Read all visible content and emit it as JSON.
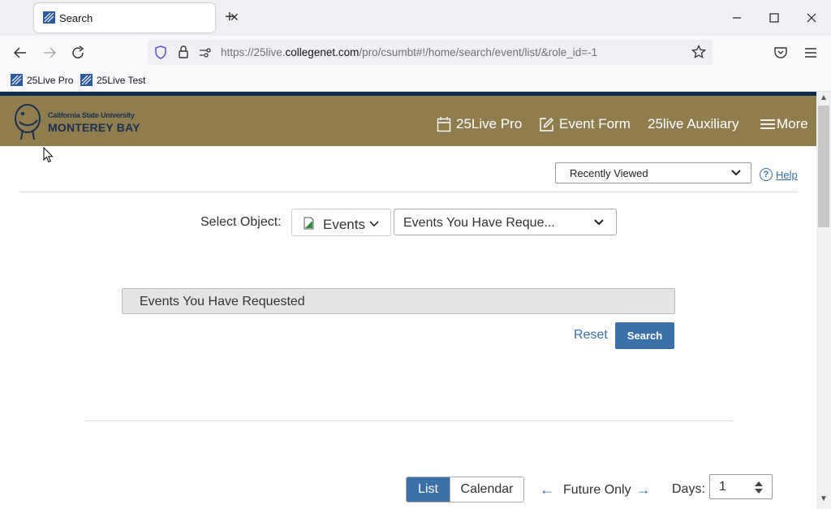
{
  "browser": {
    "tab_title": "Search",
    "url_prefix": "https://25live.",
    "url_domain": "collegenet.com",
    "url_path": "/pro/csumbt#!/home/search/event/list/&role_id=-1",
    "bookmarks": [
      "25Live Pro",
      "25Live Test"
    ]
  },
  "header": {
    "logo_line1": "California State University",
    "logo_line2": "MONTEREY BAY",
    "nav": [
      "25Live Pro",
      "Event Form",
      "25live Auxiliary",
      "More"
    ]
  },
  "toolbar": {
    "recently_viewed": "Recently Viewed",
    "help_label": "Help",
    "help_glyph": "?"
  },
  "search": {
    "select_object_label": "Select Object:",
    "object_type": "Events",
    "saved_search": "Events You Have Reque...",
    "query_text": "Events You Have Requested",
    "reset_label": "Reset",
    "search_label": "Search"
  },
  "results_controls": {
    "view_list": "List",
    "view_calendar": "Calendar",
    "future_label": "Future Only",
    "left_arrow": "←",
    "right_arrow": "→",
    "days_label": "Days:",
    "days_value": "1"
  },
  "colors": {
    "header_bg": "#8f7d50",
    "accent_blue": "#3b71a8",
    "top_stripe": "#0e2d4e"
  }
}
